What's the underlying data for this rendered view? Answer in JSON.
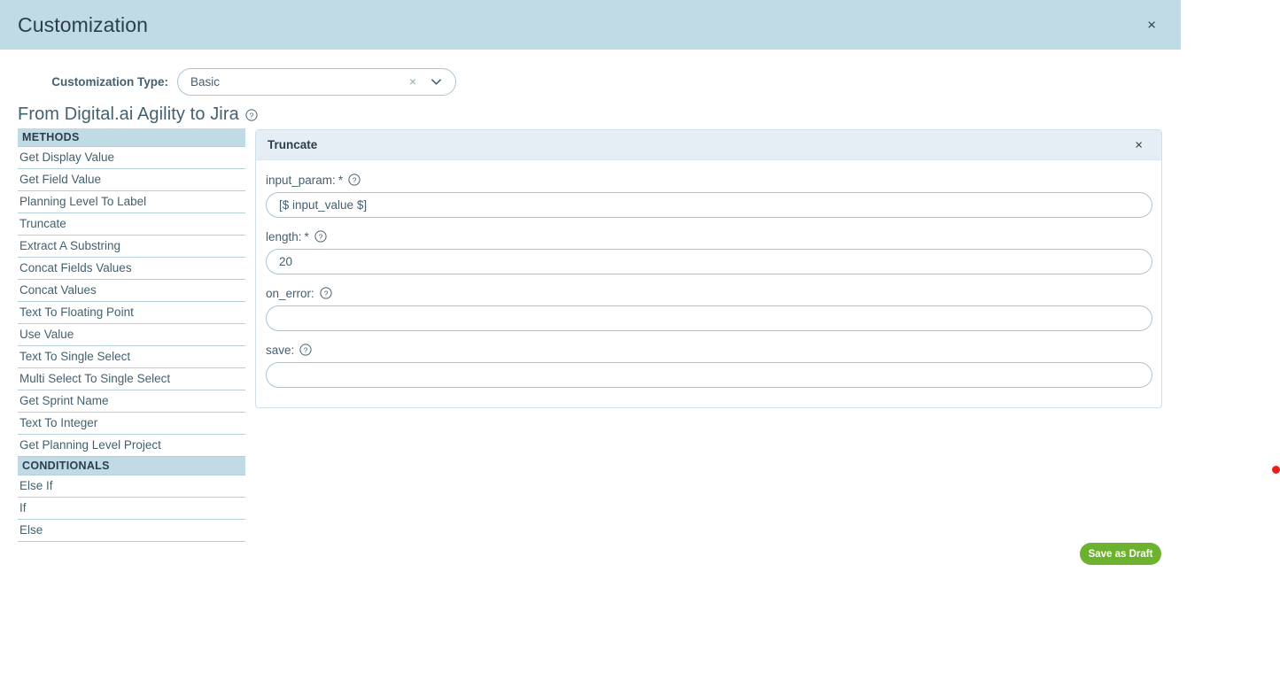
{
  "modal": {
    "title": "Customization",
    "close_label": "×"
  },
  "customization_type": {
    "label": "Customization Type:",
    "value": "Basic",
    "placeholder": "Select...",
    "clear_label": "×",
    "options": [
      "Basic"
    ]
  },
  "mapping": {
    "title": "From Digital.ai Agility to Jira",
    "help_tooltip": "?"
  },
  "side_list": {
    "groups": [
      {
        "header": "METHODS",
        "items": [
          "Get Display Value",
          "Get Field Value",
          "Planning Level To Label",
          "Truncate",
          "Extract A Substring",
          "Concat Fields Values",
          "Concat Values",
          "Text To Floating Point",
          "Use Value",
          "Text To Single Select",
          "Multi Select To Single Select",
          "Get Sprint Name",
          "Text To Integer",
          "Get Planning Level Project"
        ]
      },
      {
        "header": "CONDITIONALS",
        "items": [
          "Else If",
          "If",
          "Else"
        ]
      }
    ]
  },
  "method_panel": {
    "title": "Truncate",
    "close_label": "×",
    "fields": [
      {
        "label": "input_param:",
        "required": true,
        "value": "[$ input_value $]",
        "placeholder": ""
      },
      {
        "label": "length:",
        "required": true,
        "value": "20",
        "placeholder": ""
      },
      {
        "label": "on_error:",
        "required": false,
        "value": "",
        "placeholder": ""
      },
      {
        "label": "save:",
        "required": false,
        "value": "",
        "placeholder": ""
      }
    ]
  },
  "footer": {
    "save_draft_label": "Save as Draft"
  },
  "colors": {
    "header_bar": "#c0dbe5",
    "panel_header": "#e4eef4",
    "accent_text": "#44606f",
    "save_button": "#6cb22e",
    "indicator_dot": "#ed1c16"
  }
}
